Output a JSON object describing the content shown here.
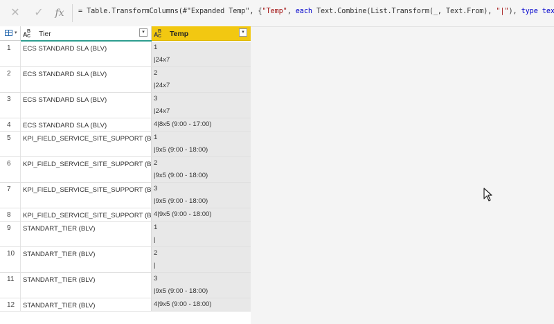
{
  "formula": {
    "prefix": "= Table.TransformColumns(#\"Expanded Temp\", {",
    "s1": "\"Temp\"",
    "mid1": ", ",
    "k1": "each",
    "mid2": " Text.Combine(List.Transform(_, Text.From), ",
    "s2": "\"|\"",
    "mid3": "), ",
    "k2": "type",
    "k3": "text",
    "suffix": "})"
  },
  "columns": {
    "tier": "Tier",
    "temp": "Temp"
  },
  "rows": [
    {
      "n": "1",
      "tier": "ECS STANDARD SLA (BLV)",
      "temp": "1\n|24x7"
    },
    {
      "n": "2",
      "tier": "ECS STANDARD SLA (BLV)",
      "temp": "2\n|24x7"
    },
    {
      "n": "3",
      "tier": "ECS STANDARD SLA (BLV)",
      "temp": "3\n|24x7"
    },
    {
      "n": "4",
      "tier": "ECS STANDARD SLA (BLV)",
      "temp": "4|8x5 (9:00 - 17:00)"
    },
    {
      "n": "5",
      "tier": "KPI_FIELD_SERVICE_SITE_SUPPORT (BLV)",
      "temp": "1\n|9x5 (9:00 - 18:00)"
    },
    {
      "n": "6",
      "tier": "KPI_FIELD_SERVICE_SITE_SUPPORT (BLV)",
      "temp": "2\n|9x5 (9:00 - 18:00)"
    },
    {
      "n": "7",
      "tier": "KPI_FIELD_SERVICE_SITE_SUPPORT (BLV)",
      "temp": "3\n|9x5 (9:00 - 18:00)"
    },
    {
      "n": "8",
      "tier": "KPI_FIELD_SERVICE_SITE_SUPPORT (BLV)",
      "temp": "4|9x5 (9:00 - 18:00)"
    },
    {
      "n": "9",
      "tier": "STANDART_TIER (BLV)",
      "temp": "1\n|"
    },
    {
      "n": "10",
      "tier": "STANDART_TIER (BLV)",
      "temp": "2\n|"
    },
    {
      "n": "11",
      "tier": "STANDART_TIER (BLV)",
      "temp": "3\n|9x5 (9:00 - 18:00)"
    },
    {
      "n": "12",
      "tier": "STANDART_TIER (BLV)",
      "temp": "4|9x5 (9:00 - 18:00)"
    }
  ],
  "icons": {
    "cancel": "close-icon",
    "confirm": "check-icon",
    "fx": "fx-icon",
    "type": "text-type-icon",
    "dropdown": "dropdown-icon"
  }
}
